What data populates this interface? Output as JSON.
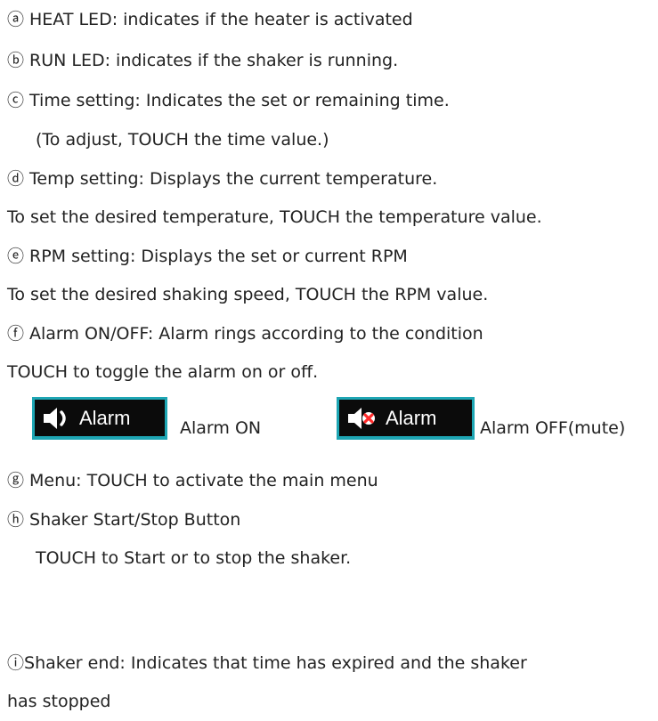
{
  "items": [
    {
      "marker": "ⓐ",
      "text": "HEAT LED: indicates if the heater is activated"
    },
    {
      "marker": "ⓑ",
      "text": "RUN LED: indicates if the shaker is running."
    },
    {
      "marker": "ⓒ",
      "text": "Time setting: Indicates the set or remaining time."
    },
    {
      "marker": "",
      "text": "(To adjust, TOUCH the time value.)"
    },
    {
      "marker": "ⓓ",
      "text": "Temp setting: Displays the current temperature."
    },
    {
      "marker": "",
      "text": "To set the desired temperature, TOUCH the temperature value."
    },
    {
      "marker": "ⓔ",
      "text": "RPM setting: Displays the set or current RPM"
    },
    {
      "marker": "",
      "text": "To set the desired shaking speed, TOUCH the RPM value."
    },
    {
      "marker": "ⓕ",
      "text": "Alarm ON/OFF: Alarm rings according to the condition"
    },
    {
      "marker": "",
      "text": "TOUCH to toggle the alarm on or off."
    },
    {
      "marker": "ⓖ",
      "text": "Menu: TOUCH to activate the main menu"
    },
    {
      "marker": "ⓗ",
      "text": "Shaker Start/Stop Button"
    },
    {
      "marker": "",
      "text": "TOUCH to Start or to stop the shaker."
    },
    {
      "marker": "ⓘ",
      "text": "Shaker end: Indicates that time has expired and the shaker"
    },
    {
      "marker": "",
      "text": "has stopped"
    }
  ],
  "alarm_examples": {
    "on": {
      "button_label": "Alarm",
      "caption": "Alarm ON",
      "icon": "speaker-on-icon"
    },
    "off": {
      "button_label": "Alarm",
      "caption": "Alarm OFF(mute)",
      "icon": "speaker-muted-icon"
    }
  },
  "colors": {
    "button_bg": "#0b0b0b",
    "button_border": "#1ea6b4",
    "mute_x": "#ff2a2a"
  }
}
